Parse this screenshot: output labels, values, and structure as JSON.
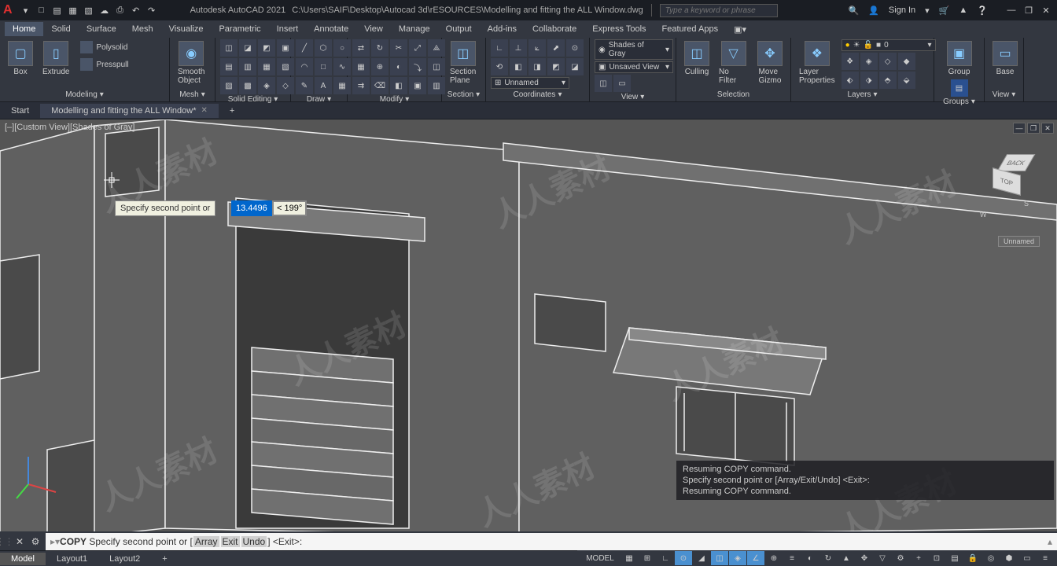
{
  "titlebar": {
    "app": "Autodesk AutoCAD 2021",
    "file": "C:\\Users\\SAIF\\Desktop\\Autocad 3d\\rESOURCES\\Modelling and fitting the ALL Window.dwg",
    "search_placeholder": "Type a keyword or phrase",
    "signin": "Sign In"
  },
  "menus": [
    "Home",
    "Solid",
    "Surface",
    "Mesh",
    "Visualize",
    "Parametric",
    "Insert",
    "Annotate",
    "View",
    "Manage",
    "Output",
    "Add-ins",
    "Collaborate",
    "Express Tools",
    "Featured Apps"
  ],
  "ribbon": {
    "modeling": {
      "title": "Modeling",
      "box": "Box",
      "extrude": "Extrude",
      "polysolid": "Polysolid",
      "presspull": "Presspull",
      "smooth": "Smooth\nObject"
    },
    "mesh": {
      "title": "Mesh"
    },
    "solid_editing": {
      "title": "Solid Editing"
    },
    "draw": {
      "title": "Draw"
    },
    "modify": {
      "title": "Modify"
    },
    "section": {
      "title": "Section",
      "plane": "Section\nPlane"
    },
    "coords": {
      "title": "Coordinates",
      "unnamed": "Unnamed"
    },
    "view": {
      "title": "View",
      "shades": "Shades of Gray",
      "unsaved": "Unsaved View"
    },
    "selection": {
      "title": "Selection",
      "culling": "Culling",
      "nofilter": "No Filter",
      "gizmo": "Move\nGizmo"
    },
    "layers": {
      "title": "Layers",
      "props": "Layer\nProperties",
      "layer0": "0"
    },
    "groups": {
      "title": "Groups",
      "group": "Group"
    },
    "viewpanel": {
      "title": "View",
      "base": "Base"
    }
  },
  "filetabs": {
    "start": "Start",
    "doc": "Modelling and fitting the ALL Window*"
  },
  "viewport": {
    "label": "[–][Custom View][Shades of Gray]",
    "unnamed": "Unnamed",
    "tooltip": "Specify second point or",
    "input_val": "13.4496",
    "input_ang": "< 199°",
    "cube": {
      "top": "TOP",
      "back": "BACK",
      "s": "S",
      "w": "W"
    }
  },
  "cmd": {
    "hist1": "Resuming COPY command.",
    "hist2": "Specify second point or [Array/Exit/Undo] <Exit>:",
    "hist3": "Resuming COPY command.",
    "name": "COPY",
    "prompt": "Specify second point or [",
    "opt1": "Array",
    "opt2": "Exit",
    "opt3": "Undo",
    "suffix": "] <Exit>:"
  },
  "layouts": [
    "Model",
    "Layout1",
    "Layout2"
  ],
  "status": {
    "model": "MODEL"
  },
  "watermark": "人人素材"
}
